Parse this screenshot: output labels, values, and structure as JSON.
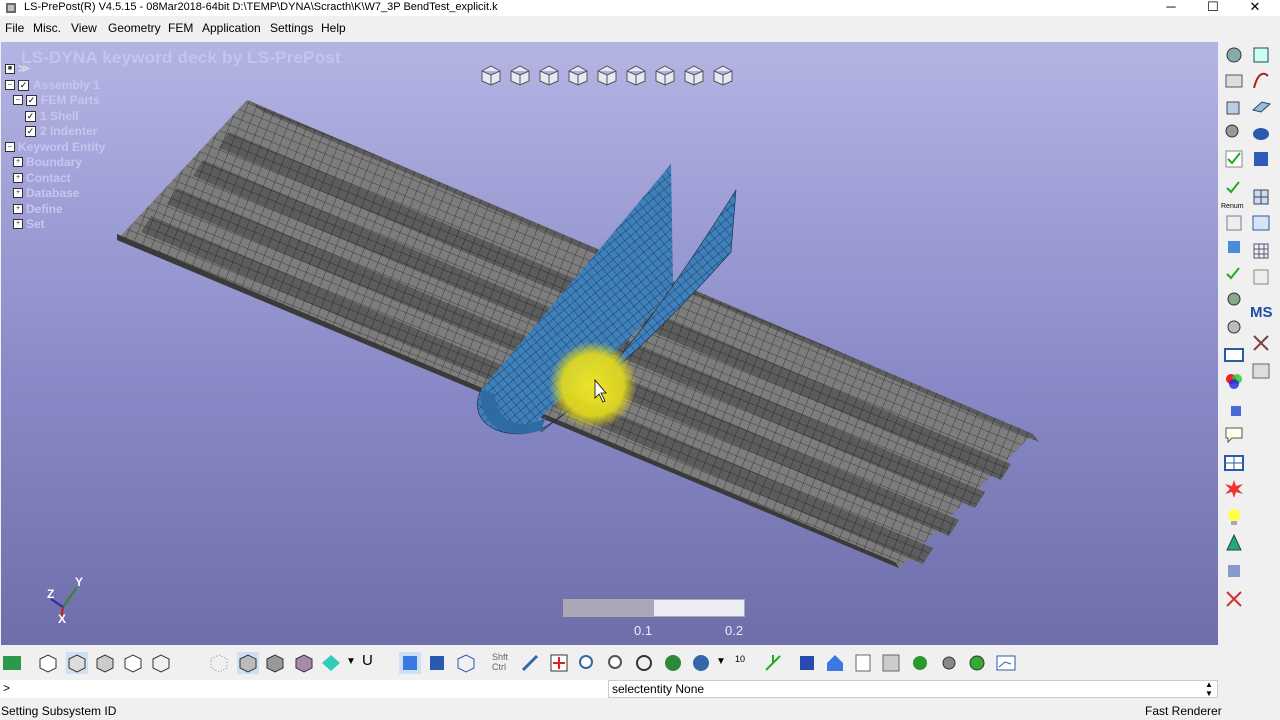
{
  "window": {
    "title": "LS-PrePost(R) V4.5.15 - 08Mar2018-64bit D:\\TEMP\\DYNA\\Scracth\\K\\W7_3P BendTest_explicit.k",
    "minimize": "─",
    "maximize": "☐",
    "close": "✕"
  },
  "menu": [
    "File",
    "Misc.",
    "View",
    "Geometry",
    "FEM",
    "Application",
    "Settings",
    "Help"
  ],
  "viewport": {
    "title": "LS-DYNA keyword deck by LS-PrePost",
    "tree": {
      "assembly": "Assembly 1",
      "fem_parts": "FEM Parts",
      "part1": "1 Shell",
      "part2": "2 Indenter",
      "keyword_entity": "Keyword Entity",
      "items": [
        "Boundary",
        "Contact",
        "Database",
        "Define",
        "Set"
      ]
    },
    "timeline": {
      "fill_fraction": 0.5,
      "tick1": "0.1",
      "tick2": "0.2"
    },
    "axis": {
      "x": "X",
      "y": "Y",
      "z": "Z"
    },
    "colors": {
      "mesh_shell": "#7a7a7a",
      "indenter": "#3f7fb8",
      "highlight": "#e8e020"
    }
  },
  "bottom": {
    "u_label": "U",
    "shft_ctrl": "Shft Ctrl",
    "ten": "10"
  },
  "right": {
    "renum": "Renum",
    "ms": "MS"
  },
  "cmdline": {
    "prompt": ">"
  },
  "select": {
    "text": "selectentity None"
  },
  "status": {
    "left": "Setting Subsystem ID",
    "right": "Fast Renderer"
  }
}
